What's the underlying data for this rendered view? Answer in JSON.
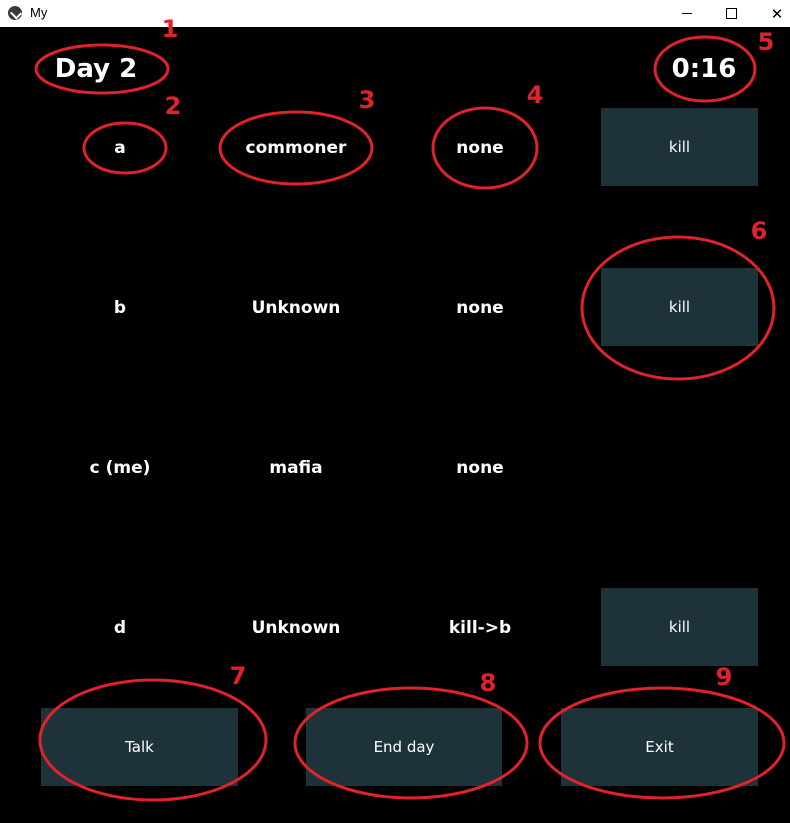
{
  "window": {
    "title": "My"
  },
  "header": {
    "day_label": "Day 2",
    "timer": "0:16"
  },
  "rows": [
    {
      "name": "a",
      "role": "commoner",
      "action": "none",
      "button": "kill"
    },
    {
      "name": "b",
      "role": "Unknown",
      "action": "none",
      "button": "kill"
    },
    {
      "name": "c (me)",
      "role": "mafia",
      "action": "none",
      "button": ""
    },
    {
      "name": "d",
      "role": "Unknown",
      "action": "kill->b",
      "button": "kill"
    }
  ],
  "footer": {
    "talk_label": "Talk",
    "end_day_label": "End day",
    "exit_label": "Exit"
  },
  "annotations": {
    "numbers": [
      "1",
      "2",
      "3",
      "4",
      "5",
      "6",
      "7",
      "8",
      "9"
    ],
    "color": "#e0222a"
  },
  "colors": {
    "background": "#000000",
    "button_bg": "#1e323a",
    "text": "#ffffff"
  }
}
